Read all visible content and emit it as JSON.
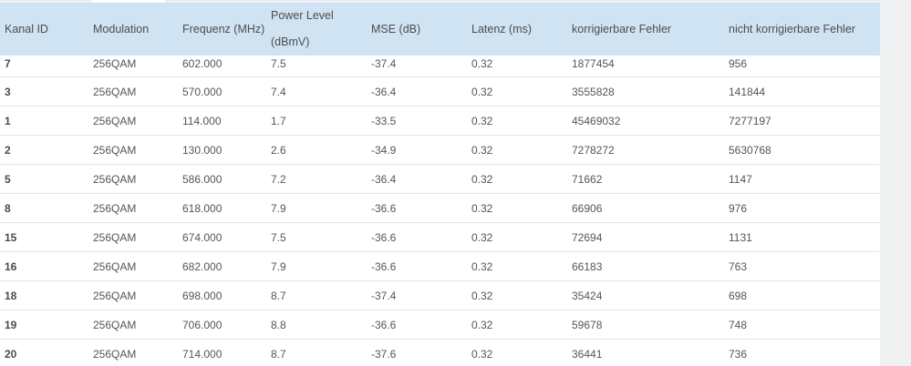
{
  "table": {
    "headers": {
      "kanal_id": "Kanal ID",
      "modulation": "Modulation",
      "frequenz": "Frequenz (MHz)",
      "power_level_line1": "Power Level",
      "power_level_line2": "(dBmV)",
      "mse": "MSE (dB)",
      "latenz": "Latenz (ms)",
      "korrigierbare": "korrigierbare Fehler",
      "nicht_korrigierbare": "nicht korrigierbare Fehler"
    },
    "rows": [
      {
        "id": "7",
        "mod": "256QAM",
        "freq": "602.000",
        "power": "7.5",
        "mse": "-37.4",
        "lat": "0.32",
        "korr": "1877454",
        "nkorr": "956"
      },
      {
        "id": "3",
        "mod": "256QAM",
        "freq": "570.000",
        "power": "7.4",
        "mse": "-36.4",
        "lat": "0.32",
        "korr": "3555828",
        "nkorr": "141844"
      },
      {
        "id": "1",
        "mod": "256QAM",
        "freq": "114.000",
        "power": "1.7",
        "mse": "-33.5",
        "lat": "0.32",
        "korr": "45469032",
        "nkorr": "7277197"
      },
      {
        "id": "2",
        "mod": "256QAM",
        "freq": "130.000",
        "power": "2.6",
        "mse": "-34.9",
        "lat": "0.32",
        "korr": "7278272",
        "nkorr": "5630768"
      },
      {
        "id": "5",
        "mod": "256QAM",
        "freq": "586.000",
        "power": "7.2",
        "mse": "-36.4",
        "lat": "0.32",
        "korr": "71662",
        "nkorr": "1147"
      },
      {
        "id": "8",
        "mod": "256QAM",
        "freq": "618.000",
        "power": "7.9",
        "mse": "-36.6",
        "lat": "0.32",
        "korr": "66906",
        "nkorr": "976"
      },
      {
        "id": "15",
        "mod": "256QAM",
        "freq": "674.000",
        "power": "7.5",
        "mse": "-36.6",
        "lat": "0.32",
        "korr": "72694",
        "nkorr": "1131"
      },
      {
        "id": "16",
        "mod": "256QAM",
        "freq": "682.000",
        "power": "7.9",
        "mse": "-36.6",
        "lat": "0.32",
        "korr": "66183",
        "nkorr": "763"
      },
      {
        "id": "18",
        "mod": "256QAM",
        "freq": "698.000",
        "power": "8.7",
        "mse": "-37.4",
        "lat": "0.32",
        "korr": "35424",
        "nkorr": "698"
      },
      {
        "id": "19",
        "mod": "256QAM",
        "freq": "706.000",
        "power": "8.8",
        "mse": "-36.6",
        "lat": "0.32",
        "korr": "59678",
        "nkorr": "748"
      },
      {
        "id": "20",
        "mod": "256QAM",
        "freq": "714.000",
        "power": "8.7",
        "mse": "-37.6",
        "lat": "0.32",
        "korr": "36441",
        "nkorr": "736"
      }
    ]
  },
  "colors": {
    "header_bg": "#cfe3f3",
    "row_border": "#e4e4e4",
    "page_bg": "#f0f1f2"
  }
}
